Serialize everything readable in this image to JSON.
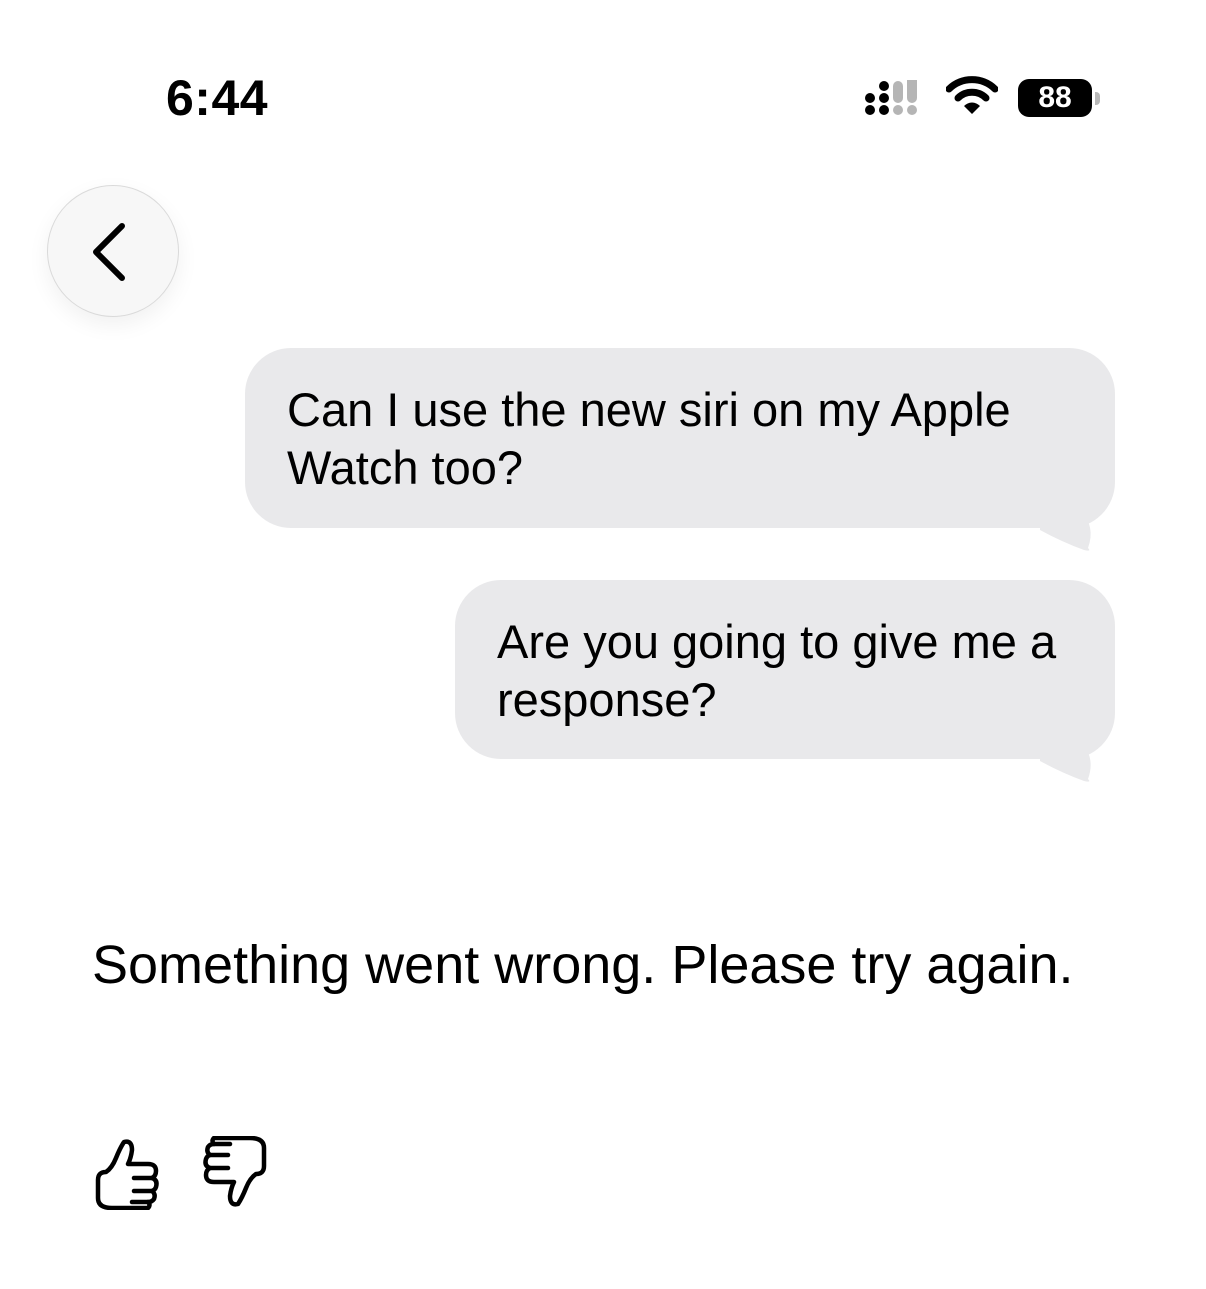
{
  "status_bar": {
    "time": "6:44",
    "battery_level": "88",
    "icons": [
      "signal-icon",
      "wifi-icon",
      "battery-icon"
    ]
  },
  "navigation": {
    "back_icon": "chevron-left-icon"
  },
  "conversation": {
    "messages": [
      {
        "sender": "user",
        "text": "Can I use the new siri on my Apple Watch too?"
      },
      {
        "sender": "user",
        "text": "Are you going to give me a response?"
      }
    ],
    "response": {
      "text": "Something went wrong. Please try again."
    }
  },
  "feedback": {
    "icons": [
      "thumbs-up-icon",
      "thumbs-down-icon"
    ]
  },
  "colors": {
    "bubble_background": "#e9e9eb",
    "page_background": "#ffffff",
    "text": "#000000"
  }
}
